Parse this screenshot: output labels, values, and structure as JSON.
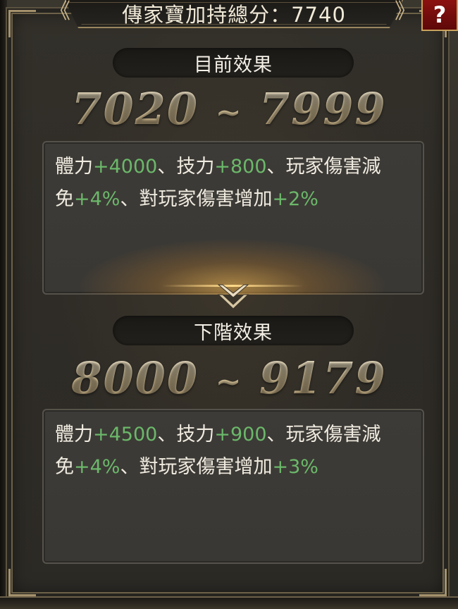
{
  "header": {
    "title": "傳家寶加持總分：7740",
    "help_label": "?"
  },
  "current": {
    "label": "目前效果",
    "range_from": "7020",
    "range_sep": "~",
    "range_to": "7999",
    "line1_parts": [
      "體力",
      "+4000",
      "、技力",
      "+800",
      "、玩家傷害減"
    ],
    "line2_parts": [
      "免",
      "+4%",
      "、對玩家傷害增加",
      "+2%"
    ]
  },
  "next": {
    "label": "下階效果",
    "range_from": "8000",
    "range_sep": "~",
    "range_to": "9179",
    "line1_parts": [
      "體力",
      "+4500",
      "、技力",
      "+900",
      "、玩家傷害減"
    ],
    "line2_parts": [
      "免",
      "+4%",
      "、對玩家傷害增加",
      "+3%"
    ]
  },
  "colors": {
    "bonus_green": "#6bb86a",
    "range_gold": "#e6d7b2",
    "help_red": "#8c1111"
  },
  "icons": {
    "divider": "double-chevron-down-icon",
    "title_ornaments": "chevron-ornament-icon"
  }
}
